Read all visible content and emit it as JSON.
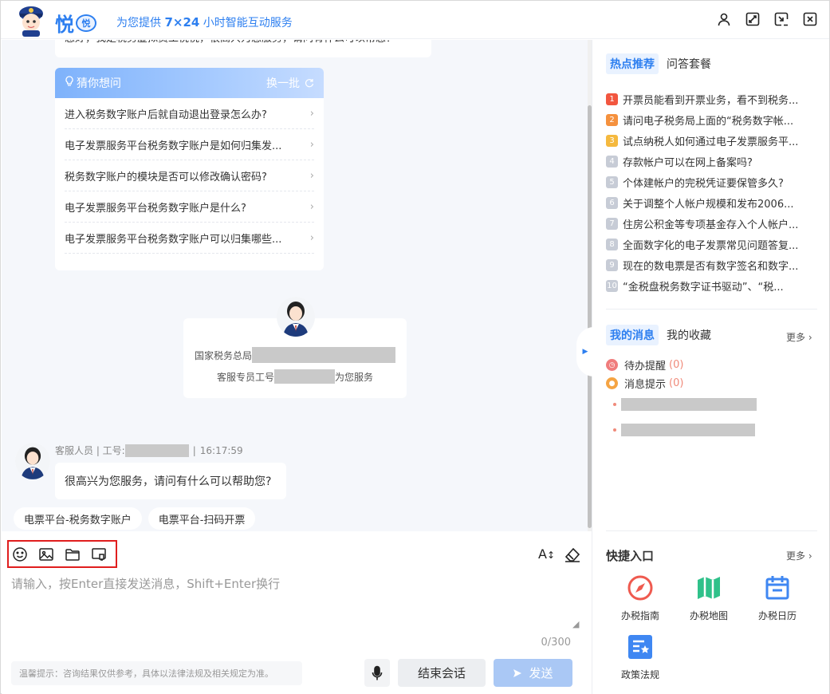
{
  "header": {
    "brand": "悦",
    "brand_badge": "悦",
    "slogan_prefix": "为您提供",
    "slogan_bold": "7×24",
    "slogan_suffix": "小时智能互动服务",
    "icons": [
      "user-icon",
      "maximize-icon",
      "minimize-to-tray-icon",
      "close-icon"
    ]
  },
  "chat": {
    "greeting_partial": "您好，我是税务虚拟员工悦悦，很高兴为您服务，请问有什么可以帮您？",
    "guess": {
      "title": "猜你想问",
      "refresh": "换一批",
      "items": [
        "进入税务数字账户后就自动退出登录怎么办?",
        "电子发票服务平台税务数字账户是如何归集发...",
        "税务数字账户的模块是否可以修改确认密码?",
        "电子发票服务平台税务数字账户是什么?",
        "电子发票服务平台税务数字账户可以归集哪些..."
      ]
    },
    "agent_card": {
      "line1_prefix": "国家税务总局",
      "line2_prefix": "客服专员工号",
      "line2_suffix": "为您服务"
    },
    "message": {
      "meta_prefix": "客服人员 | 工号:",
      "meta_sep": "|",
      "time": "16:17:59",
      "text": "很高兴为您服务，请问有什么可以帮助您?"
    },
    "chips": [
      "电票平台-税务数字账户",
      "电票平台-扫码开票"
    ]
  },
  "input": {
    "placeholder": "请输入，按Enter直接发送消息，Shift+Enter换行",
    "counter": "0/300",
    "font_label": "A",
    "tip": "温馨提示：咨询结果仅供参考，具体以法律法规及相关规定为准。",
    "end_label": "结束会话",
    "send_label": "发送",
    "toolbar_icons": [
      "emoji-icon",
      "image-icon",
      "folder-icon",
      "screenshot-icon"
    ]
  },
  "right": {
    "tab_hot": "热点推荐",
    "tab_qa": "问答套餐",
    "hot_items": [
      {
        "rank": "1",
        "text": "开票员能看到开票业务，看不到税务...",
        "color": "#f2563f"
      },
      {
        "rank": "2",
        "text": "请问电子税务局上面的“税务数字帐...",
        "color": "#f5913e"
      },
      {
        "rank": "3",
        "text": "试点纳税人如何通过电子发票服务平...",
        "color": "#f5b93e"
      },
      {
        "rank": "4",
        "text": "存款帐户可以在网上备案吗?",
        "color": "#c7ccd6"
      },
      {
        "rank": "5",
        "text": "个体建帐户的完税凭证要保管多久?",
        "color": "#c7ccd6"
      },
      {
        "rank": "6",
        "text": "关于调整个人帐户规模和发布2006...",
        "color": "#c7ccd6"
      },
      {
        "rank": "7",
        "text": "住房公积金等专项基金存入个人帐户...",
        "color": "#c7ccd6"
      },
      {
        "rank": "8",
        "text": "全面数字化的电子发票常见问题答复...",
        "color": "#c7ccd6"
      },
      {
        "rank": "9",
        "text": "现在的数电票是否有数字签名和数字...",
        "color": "#c7ccd6"
      },
      {
        "rank": "10",
        "text": "“金税盘税务数字证书驱动”、“税...",
        "color": "#c7ccd6"
      }
    ],
    "tab_msgs": "我的消息",
    "tab_fav": "我的收藏",
    "more": "更多",
    "todo_label": "待办提醒",
    "todo_count": "(0)",
    "notice_label": "消息提示",
    "notice_count": "(0)",
    "quick_title": "快捷入口",
    "quick_more": "更多",
    "quick_items": [
      {
        "label": "办税指南",
        "icon": "compass-icon"
      },
      {
        "label": "办税地图",
        "icon": "map-icon"
      },
      {
        "label": "办税日历",
        "icon": "calendar-icon"
      },
      {
        "label": "政策法规",
        "icon": "policy-doc-icon"
      }
    ]
  }
}
